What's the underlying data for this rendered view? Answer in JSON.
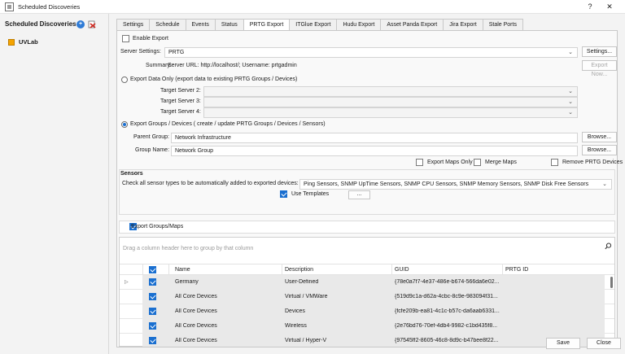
{
  "window": {
    "title": "Scheduled Discoveries",
    "help_glyph": "?",
    "close_glyph": "✕"
  },
  "sidebar": {
    "title": "Scheduled Discoveries",
    "add_glyph": "+",
    "tree_item": "UVLab"
  },
  "tabs": [
    "Settings",
    "Schedule",
    "Events",
    "Status",
    "PRTG Export",
    "ITGlue Export",
    "Hudu Export",
    "Asset Panda Export",
    "Jira Export",
    "Stale Ports"
  ],
  "active_tab": "PRTG Export",
  "export": {
    "enable_label": "Enable Export",
    "server_settings_label": "Server Settings:",
    "server_value": "PRTG",
    "settings_button": "Settings...",
    "summary_label": "Summary:",
    "summary_value": "Server URL: http://localhost/; Username: prtgadmin",
    "export_now_button": "Export Now...",
    "mode_data_only": "Export Data Only (export data to existing PRTG Groups / Devices)",
    "target_server_2": "Target Server 2:",
    "target_server_3": "Target Server 3:",
    "target_server_4": "Target Server 4:",
    "mode_groups": "Export Groups / Devices ( create / update PRTG Groups / Devices / Sensors)",
    "parent_group_label": "Parent Group:",
    "parent_group_value": "Network Infrastructure",
    "group_name_label": "Group Name:",
    "group_name_value": "Network Group",
    "browse_label": "Browse...",
    "export_maps_only": "Export Maps Only",
    "merge_maps": "Merge Maps",
    "remove_prtg_devices": "Remove PRTG Devices"
  },
  "sensors": {
    "heading": "Sensors",
    "label": "Check all sensor types to be automatically added to exported devices:",
    "value": "Ping Sensors, SNMP UpTime Sensors, SNMP CPU Sensors, SNMP Memory Sensors, SNMP Disk Free Sensors",
    "use_templates": "Use Templates",
    "ellipsis_button": "..."
  },
  "groups_maps": {
    "label": "Export Groups/Maps",
    "group_hint": "Drag a column header here to group by that column",
    "columns": [
      "Name",
      "Description",
      "GUID",
      "PRTG ID"
    ],
    "rows": [
      {
        "name": "Germany",
        "description": "User-Defined",
        "guid": "{78e0a7f7-4e37-486e-b674-566da6e02...",
        "prtg_id": ""
      },
      {
        "name": "All Core Devices",
        "description": "Virtual / VMWare",
        "guid": "{519d9c1a-d62a-4cbc-8c9e-983094f31...",
        "prtg_id": ""
      },
      {
        "name": "All Core Devices",
        "description": "Devices",
        "guid": "{fcfe209b-ea81-4c1c-b57c-da6aab6331...",
        "prtg_id": ""
      },
      {
        "name": "All Core Devices",
        "description": "Wireless",
        "guid": "{2e76bd76-70ef-4db4-9982-c1bd435f8...",
        "prtg_id": ""
      },
      {
        "name": "All Core Devices",
        "description": "Virtual / Hyper-V",
        "guid": "{97545ff2-8605-46c8-8d9c-b47bee8f22...",
        "prtg_id": ""
      }
    ]
  },
  "footer": {
    "save": "Save",
    "close": "Close"
  }
}
